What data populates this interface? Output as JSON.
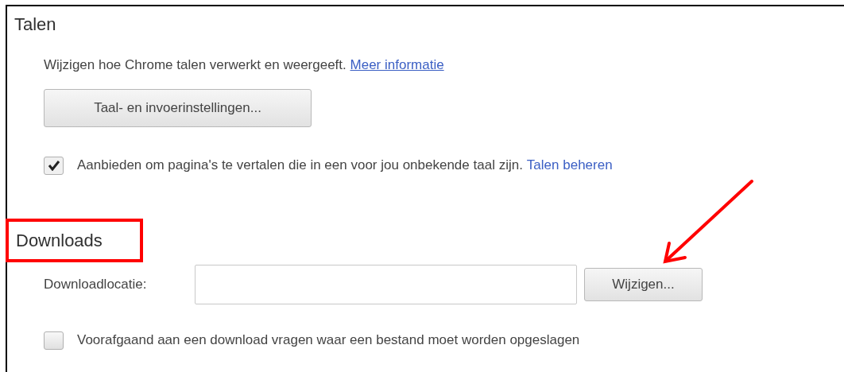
{
  "sections": [
    {
      "title": "Talen",
      "highlighted": false,
      "items": [
        {
          "kind": "text",
          "text": "Wijzigen hoe Chrome talen verwerkt en weergeeft.",
          "link": "Meer informatie"
        },
        {
          "kind": "button",
          "label": "Taal- en invoerinstellingen..."
        },
        {
          "kind": "checkbox",
          "checked": true,
          "label": "Aanbieden om pagina's te vertalen die in een voor jou onbekende taal zijn.",
          "link": "Talen beheren"
        }
      ]
    },
    {
      "title": "Downloads",
      "highlighted": true,
      "items": [
        {
          "kind": "field",
          "label": "Downloadlocatie:",
          "button": "Wijzigen..."
        },
        {
          "kind": "checkbox",
          "checked": false,
          "label": "Voorafgaand aan een download vragen waar een bestand moet worden opgeslagen"
        }
      ]
    }
  ]
}
